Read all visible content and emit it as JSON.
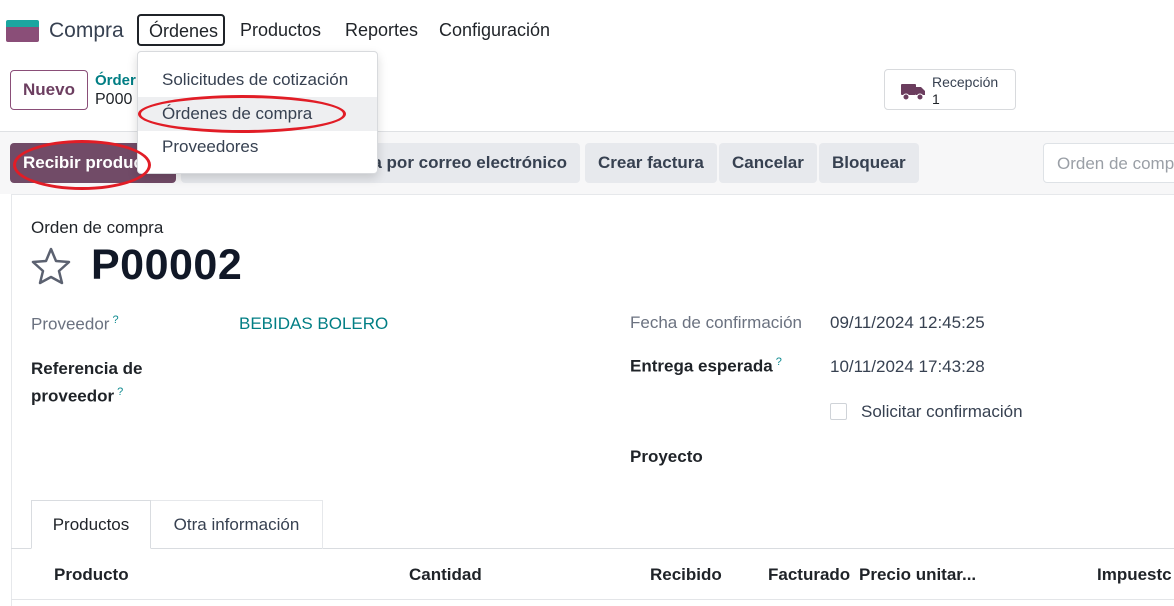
{
  "nav": {
    "app_name": "Compra",
    "menu": [
      "Órdenes",
      "Productos",
      "Reportes",
      "Configuración"
    ]
  },
  "dropdown": {
    "items": [
      "Solicitudes de cotización",
      "Órdenes de compra",
      "Proveedores"
    ],
    "highlighted": "Órdenes de compra"
  },
  "control_panel": {
    "new_label": "Nuevo",
    "breadcrumb_parent": "Órder",
    "breadcrumb_current": "P000",
    "smart_button": {
      "label": "Recepción",
      "value": "1",
      "icon": "truck-icon"
    }
  },
  "actions": {
    "receive": "Recibir produc",
    "email": "a por correo electrónico",
    "create_invoice": "Crear factura",
    "cancel": "Cancelar",
    "lock": "Bloquear",
    "state": "Orden de comp"
  },
  "form": {
    "kicker": "Orden de compra",
    "name": "P00002",
    "vendor_label": "Proveedor",
    "vendor_value": "BEBIDAS BOLERO",
    "vendor_ref_label_line1": "Referencia de",
    "vendor_ref_label_line2": "proveedor",
    "confirmation_date_label": "Fecha de confirmación",
    "confirmation_date_value": "09/11/2024 12:45:25",
    "expected_arrival_label": "Entrega esperada",
    "expected_arrival_value": "10/11/2024 17:43:28",
    "ask_confirmation_label": "Solicitar confirmación",
    "project_label": "Proyecto",
    "help_mark": "?"
  },
  "tabs": [
    "Productos",
    "Otra información"
  ],
  "table": {
    "columns": [
      "Producto",
      "Cantidad",
      "Recibido",
      "Facturado",
      "Precio unitar...",
      "Impuestc"
    ]
  },
  "colors": {
    "brand": "#714b67",
    "link": "#017e84",
    "annotation": "#e11d26"
  }
}
